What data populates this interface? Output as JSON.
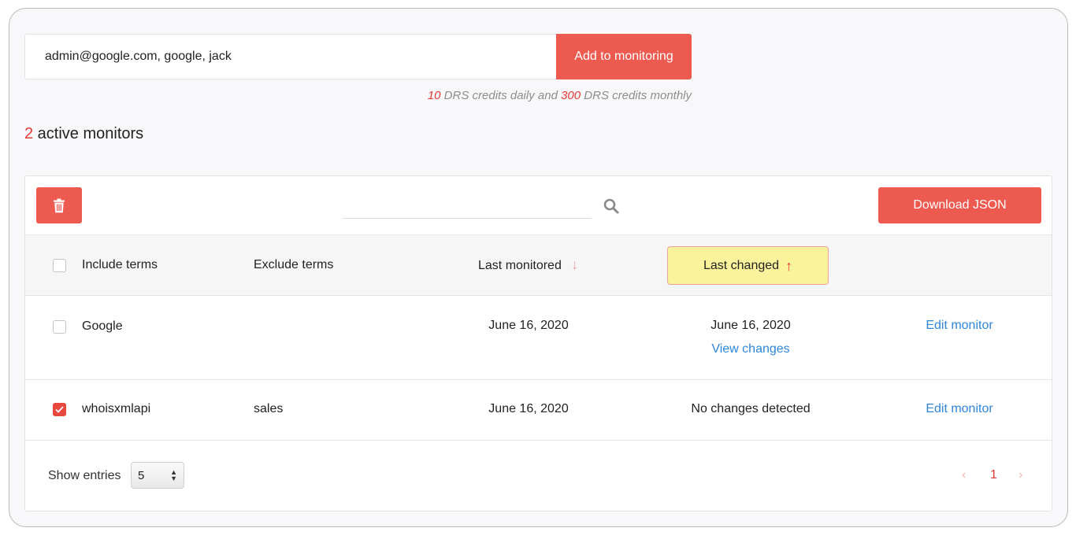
{
  "add_form": {
    "input_value": "admin@google.com, google, jack",
    "button_label": "Add to monitoring"
  },
  "credits": {
    "daily_count": "10",
    "daily_text": " DRS credits daily and ",
    "monthly_count": "300",
    "monthly_text": " DRS credits monthly"
  },
  "monitors": {
    "count": "2",
    "label": " active monitors"
  },
  "toolbar": {
    "search_placeholder": "",
    "download_label": "Download JSON"
  },
  "table": {
    "headers": {
      "include": "Include terms",
      "exclude": "Exclude terms",
      "last_monitored": "Last monitored",
      "last_changed": "Last changed"
    },
    "rows": [
      {
        "include": "Google",
        "exclude": "",
        "last_monitored": "June 16, 2020",
        "last_changed": "June 16, 2020",
        "view_changes": "View changes",
        "edit": "Edit monitor",
        "checked": false
      },
      {
        "include": "whoisxmlapi",
        "exclude": "sales",
        "last_monitored": "June 16, 2020",
        "last_changed": "No changes detected",
        "edit": "Edit monitor",
        "checked": true
      }
    ]
  },
  "footer": {
    "show_entries_label": "Show entries",
    "entries_value": "5",
    "current_page": "1",
    "prev_symbol": "‹",
    "next_symbol": "›"
  },
  "colors": {
    "accent": "#ec5a50",
    "count_red": "#e53935",
    "link_blue": "#2f86d8",
    "highlight_yellow": "#fbf29c"
  }
}
